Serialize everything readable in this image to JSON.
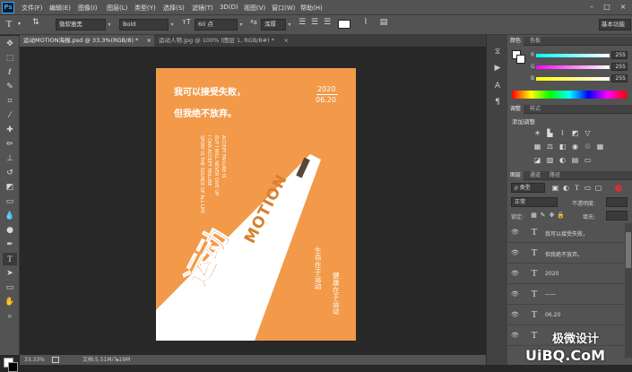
{
  "app": {
    "logo": "Ps"
  },
  "menu": [
    "文件(F)",
    "编辑(E)",
    "图像(I)",
    "图层(L)",
    "类型(Y)",
    "选择(S)",
    "滤镜(T)",
    "3D(D)",
    "视图(V)",
    "窗口(W)",
    "帮助(H)"
  ],
  "window_controls": [
    "–",
    "□",
    "×"
  ],
  "options": {
    "font_family": "微软雅黑",
    "font_style": "Bold",
    "font_size": "60 点",
    "aa": "浑厚",
    "workspace": "基本功能",
    "tool_icon": "T"
  },
  "tabs": [
    {
      "label": "运动MOTION海报.psd @ 33.3%(RGB/8) *",
      "close": "×"
    },
    {
      "label": "运动人物.jpg @ 100% (图层 1, RGB/8#) *",
      "close": "×"
    }
  ],
  "poster": {
    "headline1": "我可以接受失败，",
    "headline2": "但我绝不放弃。",
    "year": "2020",
    "date": "06.20",
    "english_lines": [
      "ACCEPT FAILURE IS",
      "BUT I WILL NEVER GIVE UP",
      "I CAN ACCEPT FAILURE",
      "SPORT IS THE SOURCE OF ALL LIFE"
    ],
    "big_word": "运动",
    "big_word_en": "MOTION",
    "vert1": "生命在于运动",
    "vert2": "健康在于运动"
  },
  "status": {
    "zoom": "33.33%",
    "doc": "文档:5.51M/7.19M"
  },
  "color_panel": {
    "tabs": [
      "颜色",
      "色板"
    ],
    "channels": [
      {
        "label": "R",
        "value": "255"
      },
      {
        "label": "G",
        "value": "255"
      },
      {
        "label": "B",
        "value": "255"
      }
    ]
  },
  "adjust_panel": {
    "tabs": [
      "调整",
      "样式"
    ],
    "title": "添加调整"
  },
  "layers_panel": {
    "tabs": [
      "图层",
      "通道",
      "路径"
    ],
    "filter": "ρ 类型",
    "blend": "正常",
    "opacity_label": "不透明度:",
    "lock_label": "锁定:",
    "fill_label": "填充:",
    "layers": [
      {
        "name": "我可以接受失败，"
      },
      {
        "name": "但我绝不放弃。"
      },
      {
        "name": "2020"
      },
      {
        "name": "——"
      },
      {
        "name": "06.20"
      },
      {
        "name": ""
      }
    ]
  },
  "watermark": {
    "brand": "极微设计",
    "site": "UiBQ.CoM"
  },
  "colors": {
    "poster": "#f29a4a",
    "chrome": "#535353",
    "canvas": "#282828"
  }
}
